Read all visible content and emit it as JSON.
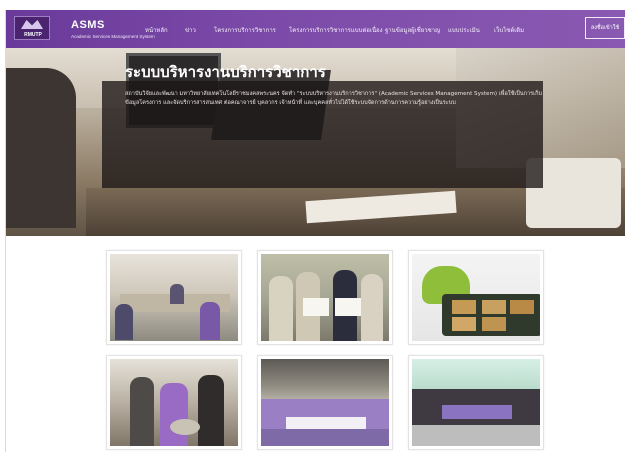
{
  "brand": {
    "logo_text": "RMUTP",
    "name": "ASMS",
    "subtitle": "Academic Services Management System"
  },
  "nav": {
    "items": [
      "หน้าหลัก",
      "ข่าว",
      "โครงการบริการวิชาการ",
      "โครงการบริการวิชาการแบบต่อเนื่อง",
      "ฐานข้อมูลผู้เชี่ยวชาญ",
      "แบบประเมิน",
      "เว็บไซต์เดิม"
    ],
    "login_label": "ลงชื่อเข้าใช้"
  },
  "hero": {
    "title": "ระบบบริหารงานบริการวิชาการ",
    "description": "สถาบันวิจัยและพัฒนา มหาวิทยาลัยเทคโนโลยีราชมงคลพระนคร จัดทำ \"ระบบบริหารงานบริการวิชาการ\" (Academic Services Management System) เพื่อใช้เป็นการเก็บข้อมูลโครงการ และจัดบริการสารสนเทศ ต่อคณาจารย์ บุคลากร เจ้าหน้าที่ และบุคคลทั่วไปได้ใช้ระบบจัดการด้านการความรู้อย่างเป็นระบบ"
  },
  "gallery": {
    "photos": [
      "meeting-room-photo",
      "certificate-handover-photo",
      "banana-product-photo",
      "community-activity-photo",
      "group-event-photo",
      "outdoor-group-photo"
    ]
  },
  "colors": {
    "nav_purple": "#7b4aa8",
    "overlay_dark": "#1c1616"
  }
}
